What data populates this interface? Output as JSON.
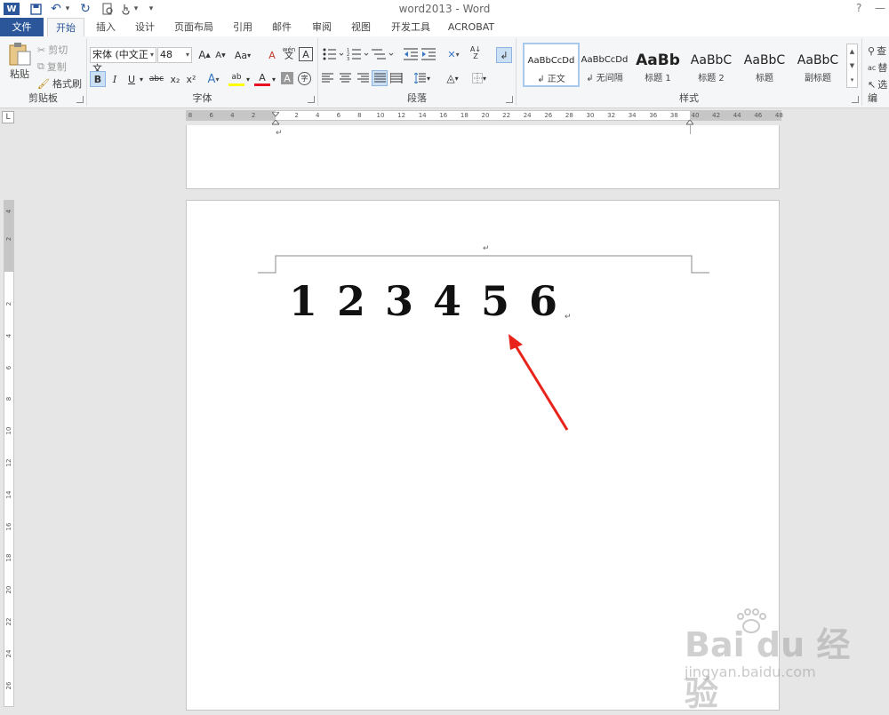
{
  "window": {
    "title": "word2013 - Word",
    "help": "?",
    "minimize": "—",
    "restore": "▢"
  },
  "quick_access": {
    "save": "▭",
    "undo": "↶",
    "undo_dd": "▾",
    "redo": "↻",
    "touch_dd": "▾",
    "customize": "▾"
  },
  "tabs": [
    "文件",
    "开始",
    "插入",
    "设计",
    "页面布局",
    "引用",
    "邮件",
    "审阅",
    "视图",
    "开发工具",
    "ACROBAT"
  ],
  "ribbon": {
    "clipboard": {
      "label": "剪贴板",
      "paste": "粘贴",
      "cut": "剪切",
      "copy": "复制",
      "format_painter": "格式刷"
    },
    "font": {
      "label": "字体",
      "font_name": "宋体 (中文正文",
      "font_size": "48",
      "grow": "A",
      "shrink": "A",
      "case": "Aa",
      "clear": "A",
      "wen": "wén",
      "wen_char": "文",
      "border_char": "A",
      "bold": "B",
      "italic": "I",
      "underline": "U",
      "strike": "abc",
      "sub": "x₂",
      "sup": "x²",
      "text_effects": "A",
      "highlight": "ab",
      "font_color": "A",
      "shading": "A",
      "enclose": "字"
    },
    "paragraph": {
      "label": "段落"
    },
    "styles": {
      "label": "样式",
      "items": [
        {
          "sample": "AaBbCcDd",
          "name": "↲ 正文"
        },
        {
          "sample": "AaBbCcDd",
          "name": "↲ 无间隔"
        },
        {
          "sample": "AaBb",
          "name": "标题 1"
        },
        {
          "sample": "AaBbC",
          "name": "标题 2"
        },
        {
          "sample": "AaBbC",
          "name": "标题"
        },
        {
          "sample": "AaBbC",
          "name": "副标题"
        }
      ]
    },
    "editing": {
      "label": "编",
      "find": "查",
      "replace": "替",
      "select": "选"
    }
  },
  "ruler": {
    "h_numbers": [
      "8",
      "6",
      "4",
      "2",
      "2",
      "4",
      "6",
      "8",
      "10",
      "12",
      "14",
      "16",
      "18",
      "20",
      "22",
      "24",
      "26",
      "28",
      "30",
      "32",
      "34",
      "36",
      "38",
      "40",
      "42",
      "44",
      "46",
      "48"
    ],
    "v_numbers": [
      "4",
      "2",
      "2",
      "4",
      "6",
      "8",
      "10",
      "12",
      "14",
      "16",
      "18",
      "20",
      "22",
      "24",
      "26"
    ],
    "tab_button": "L"
  },
  "document": {
    "digits": [
      "1",
      "2",
      "3",
      "4",
      "5",
      "6"
    ],
    "paragraph_mark": "↵"
  },
  "watermark": {
    "text": "Bai du 经验",
    "url": "jingyan.baidu.com"
  },
  "colors": {
    "file_tab": "#2b579a",
    "accent": "#2b579a",
    "arrow": "#e8231a"
  }
}
